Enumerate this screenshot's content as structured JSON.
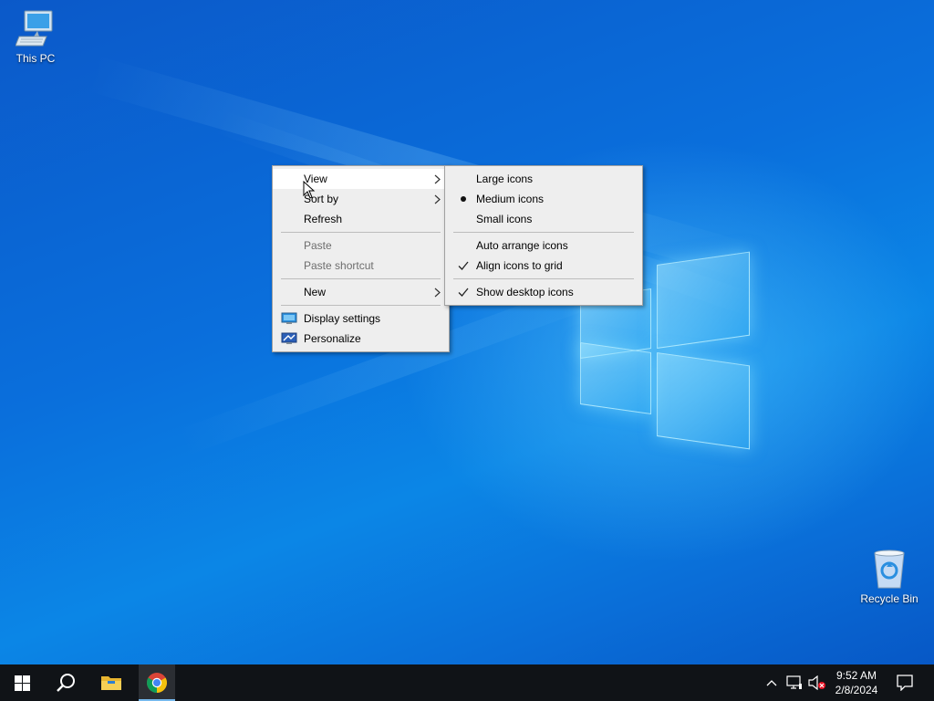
{
  "desktop": {
    "icons": [
      {
        "label": "This PC"
      },
      {
        "label": "Recycle Bin"
      }
    ]
  },
  "context_menu": {
    "items": {
      "view": "View",
      "sort_by": "Sort by",
      "refresh": "Refresh",
      "paste": "Paste",
      "paste_shortcut": "Paste shortcut",
      "new": "New",
      "display_settings": "Display settings",
      "personalize": "Personalize"
    }
  },
  "view_submenu": {
    "items": {
      "large_icons": "Large icons",
      "medium_icons": "Medium icons",
      "small_icons": "Small icons",
      "auto_arrange": "Auto arrange icons",
      "align_to_grid": "Align icons to grid",
      "show_desktop_icons": "Show desktop icons"
    },
    "selected_size": "Medium icons",
    "checked": [
      "Align icons to grid",
      "Show desktop icons"
    ]
  },
  "taskbar": {
    "clock": {
      "time": "9:52 AM",
      "date": "2/8/2024"
    }
  },
  "colors": {
    "taskbar": "#101317",
    "menu_bg": "#eeeeee",
    "accent": "#0a6fdc"
  }
}
